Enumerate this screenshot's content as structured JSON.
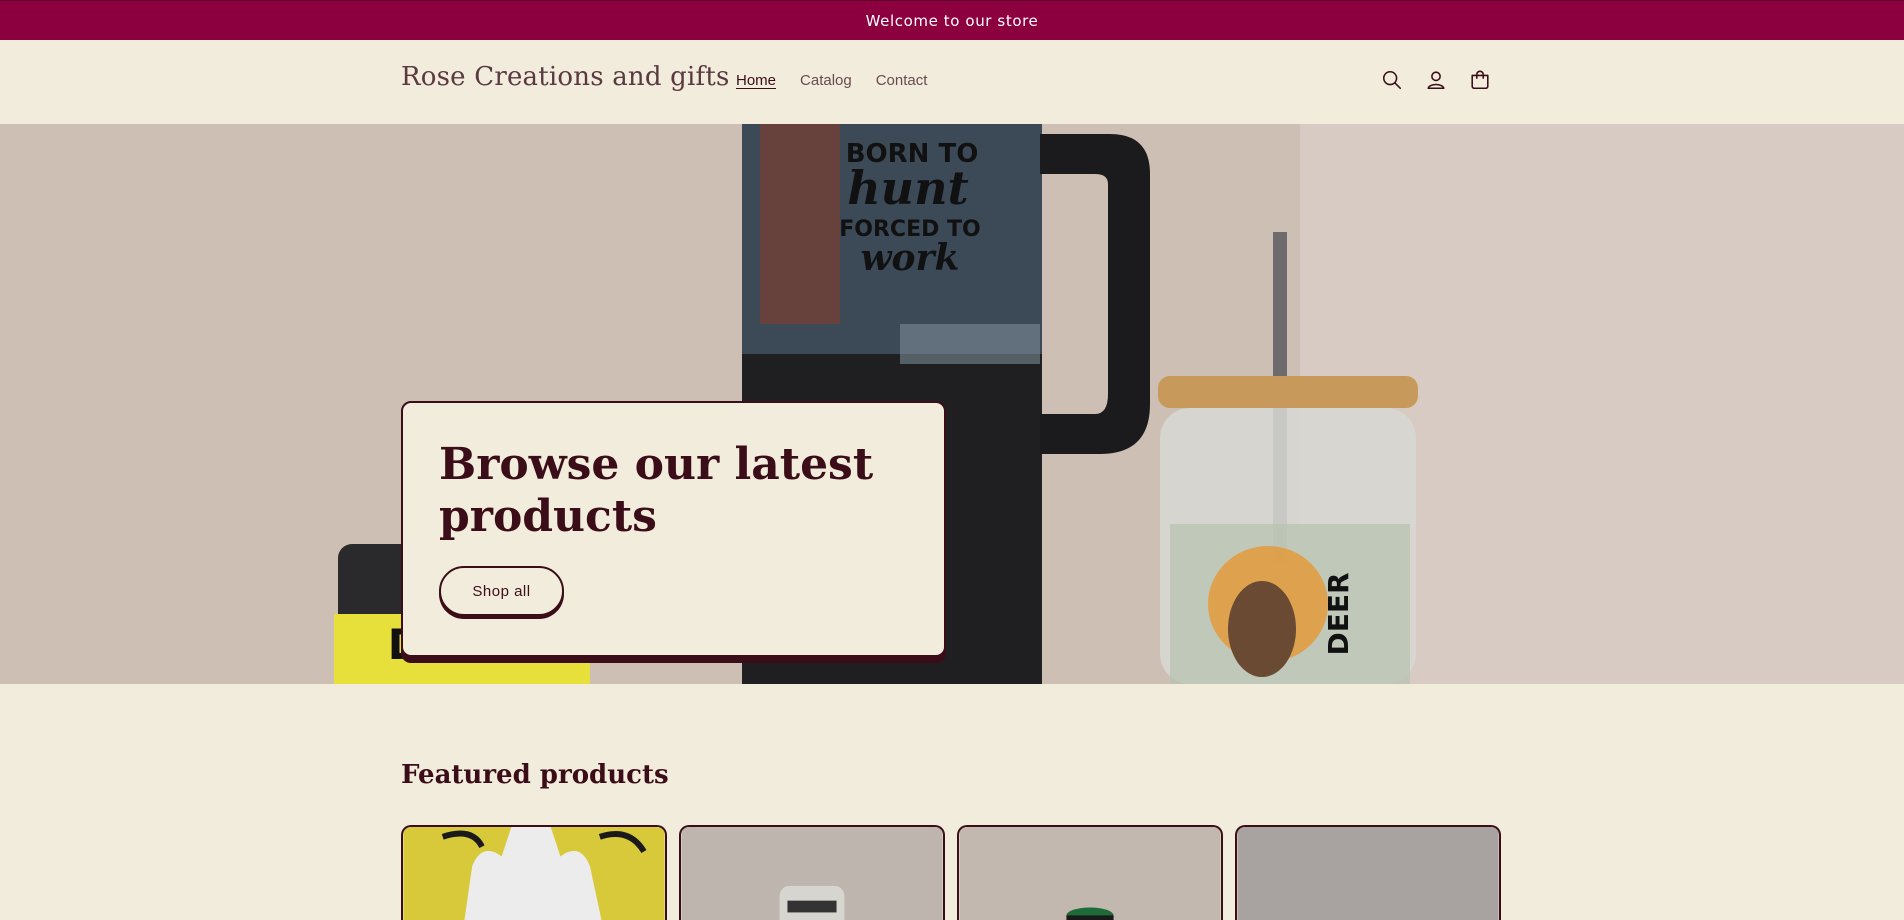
{
  "announcement": {
    "text": "Welcome to our store"
  },
  "header": {
    "brand": "Rose Creations and gifts",
    "nav": [
      {
        "label": "Home",
        "active": true
      },
      {
        "label": "Catalog",
        "active": false
      },
      {
        "label": "Contact",
        "active": false
      }
    ],
    "icons": [
      "search-icon",
      "account-icon",
      "cart-icon"
    ]
  },
  "hero": {
    "title": "Browse our latest products",
    "button": "Shop all",
    "image_text": {
      "tumbler": [
        "BORN TO",
        "hunt",
        "FORCED TO",
        "work"
      ],
      "can": "DEER",
      "jar": "DEER"
    }
  },
  "featured": {
    "title": "Featured products",
    "products": [
      {
        "name": "product-apron"
      },
      {
        "name": "product-jar"
      },
      {
        "name": "product-can-cooler"
      },
      {
        "name": "product-item"
      }
    ]
  },
  "colors": {
    "brand": "#8c0040",
    "text": "#3b0d18",
    "background": "#f1ecdc"
  }
}
